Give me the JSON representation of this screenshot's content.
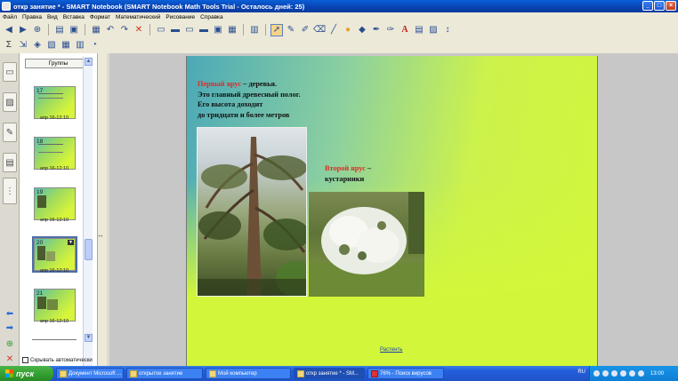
{
  "window": {
    "title": "откр занятие *  - SMART Notebook (SMART Notebook Math Tools Trial - Осталось дней: 25)"
  },
  "menu": [
    "Файл",
    "Правка",
    "Вид",
    "Вставка",
    "Формат",
    "Математический",
    "Рисование",
    "Справка"
  ],
  "toolbar1_icons": [
    "back-icon",
    "forward-icon",
    "add-page-icon",
    "open-icon",
    "save-icon",
    "paste-icon",
    "undo-icon",
    "redo-icon",
    "delete-icon",
    "screen-shade-icon",
    "display-icon",
    "display-icon",
    "display-icon",
    "display-icon",
    "capture-icon",
    "table-icon",
    "select-icon",
    "pen-icon",
    "creative-pen-icon",
    "eraser-icon",
    "line-icon",
    "shape-icon",
    "fill-icon",
    "magic-pen-icon",
    "shape-recognition-icon",
    "text-icon",
    "properties-icon",
    "image-icon",
    "move-icon"
  ],
  "sorter": {
    "groups_label": "Группы",
    "thumbs": [
      {
        "num": "17",
        "caption": "апр 16-12:10"
      },
      {
        "num": "18",
        "caption": "апр 16-12:10"
      },
      {
        "num": "19",
        "caption": "апр 16-12:10"
      },
      {
        "num": "20",
        "caption": "апр 16-12:10"
      },
      {
        "num": "21",
        "caption": "апр 16-12:10"
      }
    ],
    "autohide_label": "Скрывать автоматически"
  },
  "slide": {
    "tier1_title": "Первый ярус",
    "tier1_rest": " – деревья.",
    "tier1_line2": "Это главный древесный полог.",
    "tier1_line3": "Его высота доходит",
    "tier1_line4": "до тридцати и более метров",
    "tier2_title": "Второй ярус",
    "tier2_rest": " –",
    "tier2_line2": "кустарники",
    "footer_link": "Растенть"
  },
  "taskbar": {
    "start": "пуск",
    "tasks": [
      "Документ Microsoft ...",
      "открытое занятие",
      "Мой компьютер",
      "откр занятие * - SM...",
      "76% - Поиск вирусов"
    ],
    "lang": "RU",
    "clock": "13:00"
  }
}
